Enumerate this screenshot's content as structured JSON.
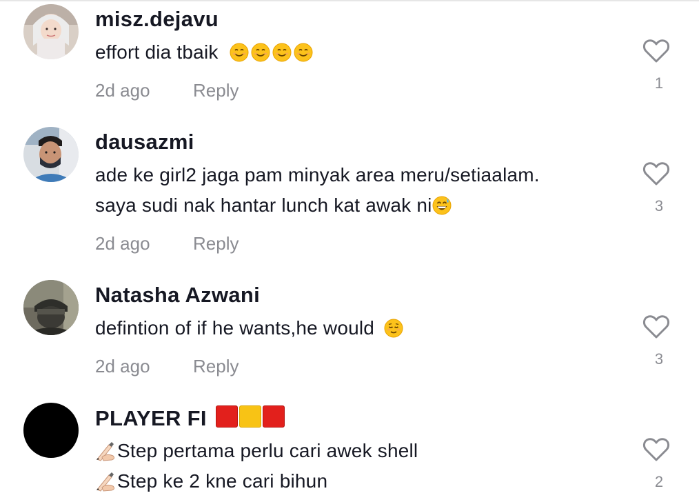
{
  "comments": [
    {
      "username": "misz.dejavu",
      "text_lines": [
        "effort dia tbaik"
      ],
      "emojis": [
        "smiling-face-emoji",
        "smiling-face-emoji",
        "smiling-face-emoji",
        "smiling-face-emoji"
      ],
      "time": "2d ago",
      "reply_label": "Reply",
      "likes": "1"
    },
    {
      "username": "dausazmi",
      "text_lines": [
        "ade ke girl2 jaga pam minyak area meru/setiaalam.",
        "saya sudi nak hantar lunch kat awak ni"
      ],
      "emojis": [
        "grinning-sweat-emoji"
      ],
      "time": "2d ago",
      "reply_label": "Reply",
      "likes": "3"
    },
    {
      "username": "Natasha Azwani",
      "text_lines": [
        "defintion of if he wants,he would "
      ],
      "emojis": [
        "relieved-face-emoji"
      ],
      "time": "2d ago",
      "reply_label": "Reply",
      "likes": "3"
    },
    {
      "username": "PLAYER FI",
      "username_emojis": [
        "red-square-emoji",
        "yellow-square-emoji",
        "red-square-emoji"
      ],
      "text_lines": [
        "Step pertama perlu cari awek shell",
        "Step ke 2 kne cari bihun"
      ],
      "line_prefix_icon": "writing-hand-emoji",
      "likes": "2"
    }
  ],
  "icons": {
    "like": "heart-outline-icon"
  },
  "colors": {
    "text_primary": "#161823",
    "text_secondary": "#8a8b91",
    "heart_stroke": "#8a8b91"
  }
}
